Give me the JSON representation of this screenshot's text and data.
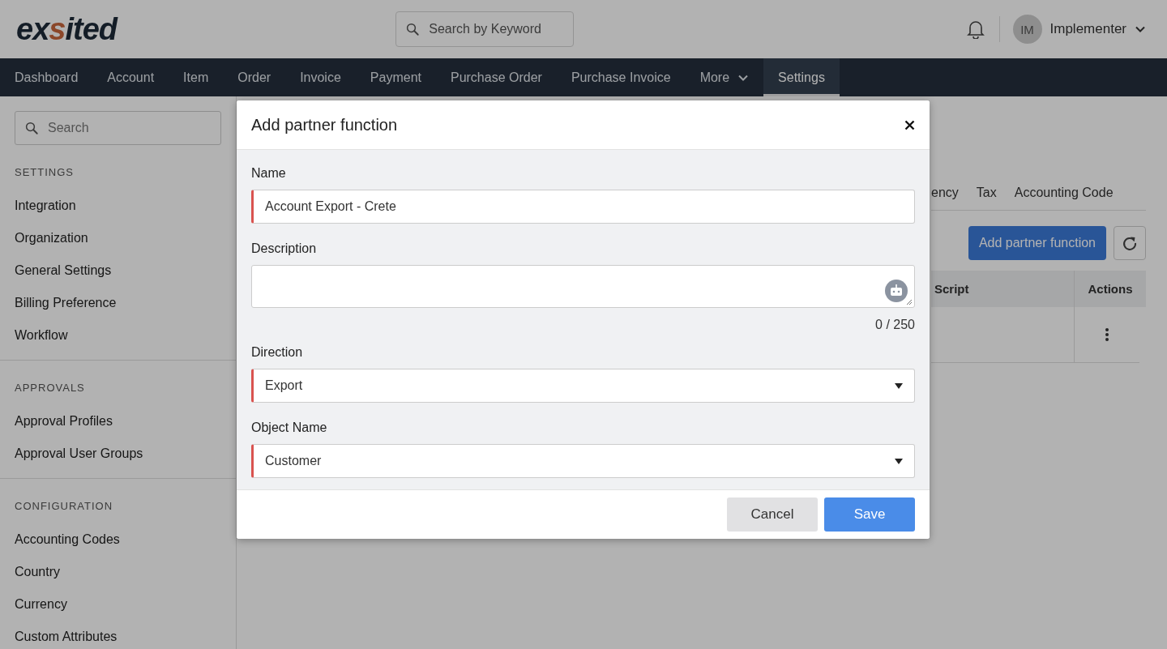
{
  "header": {
    "logo": {
      "start": "ex",
      "mark": "s",
      "end": "ited"
    },
    "search": {
      "placeholder": "Search by Keyword"
    },
    "user": {
      "initials": "IM",
      "name": "Implementer"
    }
  },
  "nav": [
    {
      "label": "Dashboard",
      "selected": false,
      "has_menu": false
    },
    {
      "label": "Account",
      "selected": false,
      "has_menu": false
    },
    {
      "label": "Item",
      "selected": false,
      "has_menu": false
    },
    {
      "label": "Order",
      "selected": false,
      "has_menu": false
    },
    {
      "label": "Invoice",
      "selected": false,
      "has_menu": false
    },
    {
      "label": "Payment",
      "selected": false,
      "has_menu": false
    },
    {
      "label": "Purchase Order",
      "selected": false,
      "has_menu": false
    },
    {
      "label": "Purchase Invoice",
      "selected": false,
      "has_menu": false
    },
    {
      "label": "More",
      "selected": false,
      "has_menu": true
    },
    {
      "label": "Settings",
      "selected": true,
      "has_menu": false
    }
  ],
  "sidebar": {
    "search": {
      "placeholder": "Search"
    },
    "sections": [
      {
        "title": "SETTINGS",
        "items": [
          "Integration",
          "Organization",
          "General Settings",
          "Billing Preference",
          "Workflow"
        ]
      },
      {
        "title": "APPROVALS",
        "items": [
          "Approval Profiles",
          "Approval User Groups"
        ]
      },
      {
        "title": "CONFIGURATION",
        "items": [
          "Accounting Codes",
          "Country",
          "Currency",
          "Custom Attributes"
        ]
      }
    ]
  },
  "main": {
    "tabs": [
      {
        "label": "ency",
        "selected": false
      },
      {
        "label": "Tax",
        "selected": false
      },
      {
        "label": "Accounting Code",
        "selected": false
      }
    ],
    "add_button": "Add partner function",
    "table": {
      "columns": [
        "Script",
        "Actions"
      ]
    }
  },
  "dialog": {
    "title": "Add partner function",
    "fields": [
      {
        "kind": "text",
        "label": "Name",
        "value": "Account Export - Crete",
        "required": true
      },
      {
        "kind": "textarea",
        "label": "Description",
        "counter": "0 / 250",
        "required": false
      },
      {
        "kind": "select",
        "label": "Direction",
        "value": "Export",
        "required": true
      },
      {
        "kind": "select",
        "label": "Object Name",
        "value": "Customer",
        "required": true
      }
    ],
    "buttons": [
      {
        "label": "Cancel",
        "kind": "secondary"
      },
      {
        "label": "Save",
        "kind": "primary"
      }
    ]
  }
}
